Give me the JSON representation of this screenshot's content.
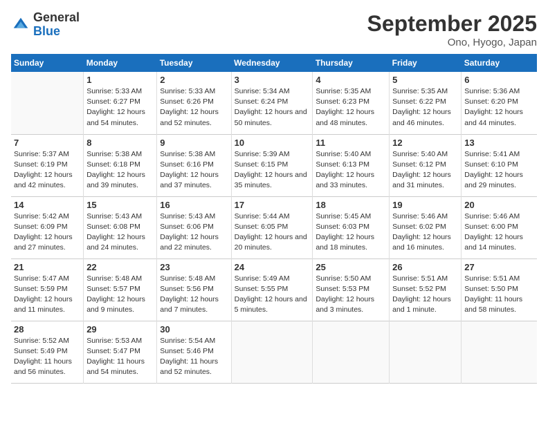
{
  "header": {
    "logo_general": "General",
    "logo_blue": "Blue",
    "month_title": "September 2025",
    "location": "Ono, Hyogo, Japan"
  },
  "days_of_week": [
    "Sunday",
    "Monday",
    "Tuesday",
    "Wednesday",
    "Thursday",
    "Friday",
    "Saturday"
  ],
  "weeks": [
    [
      {
        "day": "",
        "sunrise": "",
        "sunset": "",
        "daylight": ""
      },
      {
        "day": "1",
        "sunrise": "Sunrise: 5:33 AM",
        "sunset": "Sunset: 6:27 PM",
        "daylight": "Daylight: 12 hours and 54 minutes."
      },
      {
        "day": "2",
        "sunrise": "Sunrise: 5:33 AM",
        "sunset": "Sunset: 6:26 PM",
        "daylight": "Daylight: 12 hours and 52 minutes."
      },
      {
        "day": "3",
        "sunrise": "Sunrise: 5:34 AM",
        "sunset": "Sunset: 6:24 PM",
        "daylight": "Daylight: 12 hours and 50 minutes."
      },
      {
        "day": "4",
        "sunrise": "Sunrise: 5:35 AM",
        "sunset": "Sunset: 6:23 PM",
        "daylight": "Daylight: 12 hours and 48 minutes."
      },
      {
        "day": "5",
        "sunrise": "Sunrise: 5:35 AM",
        "sunset": "Sunset: 6:22 PM",
        "daylight": "Daylight: 12 hours and 46 minutes."
      },
      {
        "day": "6",
        "sunrise": "Sunrise: 5:36 AM",
        "sunset": "Sunset: 6:20 PM",
        "daylight": "Daylight: 12 hours and 44 minutes."
      }
    ],
    [
      {
        "day": "7",
        "sunrise": "Sunrise: 5:37 AM",
        "sunset": "Sunset: 6:19 PM",
        "daylight": "Daylight: 12 hours and 42 minutes."
      },
      {
        "day": "8",
        "sunrise": "Sunrise: 5:38 AM",
        "sunset": "Sunset: 6:18 PM",
        "daylight": "Daylight: 12 hours and 39 minutes."
      },
      {
        "day": "9",
        "sunrise": "Sunrise: 5:38 AM",
        "sunset": "Sunset: 6:16 PM",
        "daylight": "Daylight: 12 hours and 37 minutes."
      },
      {
        "day": "10",
        "sunrise": "Sunrise: 5:39 AM",
        "sunset": "Sunset: 6:15 PM",
        "daylight": "Daylight: 12 hours and 35 minutes."
      },
      {
        "day": "11",
        "sunrise": "Sunrise: 5:40 AM",
        "sunset": "Sunset: 6:13 PM",
        "daylight": "Daylight: 12 hours and 33 minutes."
      },
      {
        "day": "12",
        "sunrise": "Sunrise: 5:40 AM",
        "sunset": "Sunset: 6:12 PM",
        "daylight": "Daylight: 12 hours and 31 minutes."
      },
      {
        "day": "13",
        "sunrise": "Sunrise: 5:41 AM",
        "sunset": "Sunset: 6:10 PM",
        "daylight": "Daylight: 12 hours and 29 minutes."
      }
    ],
    [
      {
        "day": "14",
        "sunrise": "Sunrise: 5:42 AM",
        "sunset": "Sunset: 6:09 PM",
        "daylight": "Daylight: 12 hours and 27 minutes."
      },
      {
        "day": "15",
        "sunrise": "Sunrise: 5:43 AM",
        "sunset": "Sunset: 6:08 PM",
        "daylight": "Daylight: 12 hours and 24 minutes."
      },
      {
        "day": "16",
        "sunrise": "Sunrise: 5:43 AM",
        "sunset": "Sunset: 6:06 PM",
        "daylight": "Daylight: 12 hours and 22 minutes."
      },
      {
        "day": "17",
        "sunrise": "Sunrise: 5:44 AM",
        "sunset": "Sunset: 6:05 PM",
        "daylight": "Daylight: 12 hours and 20 minutes."
      },
      {
        "day": "18",
        "sunrise": "Sunrise: 5:45 AM",
        "sunset": "Sunset: 6:03 PM",
        "daylight": "Daylight: 12 hours and 18 minutes."
      },
      {
        "day": "19",
        "sunrise": "Sunrise: 5:46 AM",
        "sunset": "Sunset: 6:02 PM",
        "daylight": "Daylight: 12 hours and 16 minutes."
      },
      {
        "day": "20",
        "sunrise": "Sunrise: 5:46 AM",
        "sunset": "Sunset: 6:00 PM",
        "daylight": "Daylight: 12 hours and 14 minutes."
      }
    ],
    [
      {
        "day": "21",
        "sunrise": "Sunrise: 5:47 AM",
        "sunset": "Sunset: 5:59 PM",
        "daylight": "Daylight: 12 hours and 11 minutes."
      },
      {
        "day": "22",
        "sunrise": "Sunrise: 5:48 AM",
        "sunset": "Sunset: 5:57 PM",
        "daylight": "Daylight: 12 hours and 9 minutes."
      },
      {
        "day": "23",
        "sunrise": "Sunrise: 5:48 AM",
        "sunset": "Sunset: 5:56 PM",
        "daylight": "Daylight: 12 hours and 7 minutes."
      },
      {
        "day": "24",
        "sunrise": "Sunrise: 5:49 AM",
        "sunset": "Sunset: 5:55 PM",
        "daylight": "Daylight: 12 hours and 5 minutes."
      },
      {
        "day": "25",
        "sunrise": "Sunrise: 5:50 AM",
        "sunset": "Sunset: 5:53 PM",
        "daylight": "Daylight: 12 hours and 3 minutes."
      },
      {
        "day": "26",
        "sunrise": "Sunrise: 5:51 AM",
        "sunset": "Sunset: 5:52 PM",
        "daylight": "Daylight: 12 hours and 1 minute."
      },
      {
        "day": "27",
        "sunrise": "Sunrise: 5:51 AM",
        "sunset": "Sunset: 5:50 PM",
        "daylight": "Daylight: 11 hours and 58 minutes."
      }
    ],
    [
      {
        "day": "28",
        "sunrise": "Sunrise: 5:52 AM",
        "sunset": "Sunset: 5:49 PM",
        "daylight": "Daylight: 11 hours and 56 minutes."
      },
      {
        "day": "29",
        "sunrise": "Sunrise: 5:53 AM",
        "sunset": "Sunset: 5:47 PM",
        "daylight": "Daylight: 11 hours and 54 minutes."
      },
      {
        "day": "30",
        "sunrise": "Sunrise: 5:54 AM",
        "sunset": "Sunset: 5:46 PM",
        "daylight": "Daylight: 11 hours and 52 minutes."
      },
      {
        "day": "",
        "sunrise": "",
        "sunset": "",
        "daylight": ""
      },
      {
        "day": "",
        "sunrise": "",
        "sunset": "",
        "daylight": ""
      },
      {
        "day": "",
        "sunrise": "",
        "sunset": "",
        "daylight": ""
      },
      {
        "day": "",
        "sunrise": "",
        "sunset": "",
        "daylight": ""
      }
    ]
  ]
}
